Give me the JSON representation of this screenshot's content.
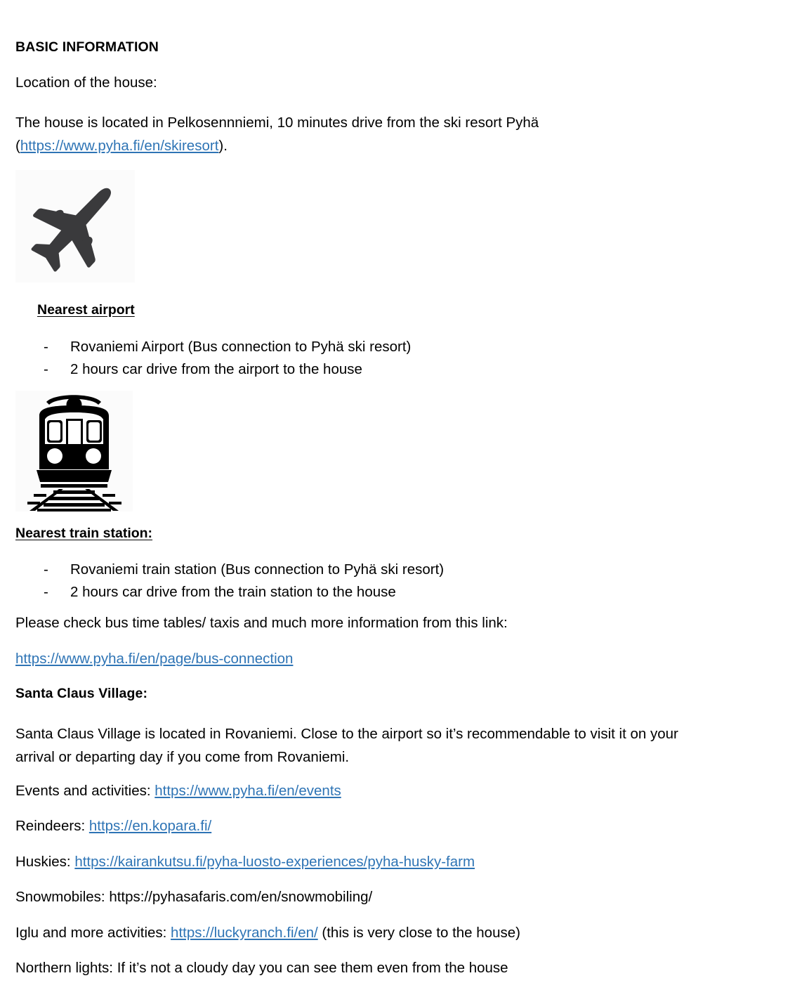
{
  "document": {
    "title": "BASIC INFORMATION",
    "location_label": "Location of the house:",
    "location_text_before": " The house is located in Pelkosennniemi, 10 minutes drive from the ski resort Pyhä (",
    "location_link": "https://www.pyha.fi/en/skiresort",
    "location_text_after": ")."
  },
  "airport_section": {
    "icon": "airplane-icon",
    "heading": "Nearest airport",
    "items": [
      {
        "dash": "-",
        "text": "Rovaniemi Airport (Bus connection to Pyhä ski resort)"
      },
      {
        "dash": "-",
        "text": "2 hours car drive from the airport to the house"
      }
    ]
  },
  "train_section": {
    "icon": "train-icon",
    "heading": "Nearest train station:",
    "items": [
      {
        "dash": "-",
        "text": "Rovaniemi train station (Bus connection to Pyhä ski resort)"
      },
      {
        "dash": "-",
        "text": "2 hours car drive from the train station to the house"
      }
    ],
    "bus_note": "Please check bus time tables/ taxis and much more information from this link:",
    "bus_link": "https://www.pyha.fi/en/page/bus-connection"
  },
  "santa_section": {
    "heading": "Santa Claus Village:",
    "description": "Santa Claus Village is located in Rovaniemi. Close to the airport so it’s recommendable to visit it on your arrival or departing day if you come from Rovaniemi."
  },
  "activities": {
    "events_label": "Events and activities: ",
    "events_link": "https://www.pyha.fi/en/events",
    "reindeers_label": "Reindeers: ",
    "reindeers_link": "https://en.kopara.fi/",
    "huskies_label": "Huskies: ",
    "huskies_link": "https://kairankutsu.fi/pyha-luosto-experiences/pyha-husky-farm",
    "snowmobiles_label": "Snowmobiles: ",
    "snowmobiles_url": "https://pyhasafaris.com/en/snowmobiling/",
    "iglu_label": "Iglu and more activities: ",
    "iglu_link": "https://luckyranch.fi/en/",
    "iglu_suffix": "  (this is very close to the house)",
    "northern_lights": "Northern lights: If it’s not a cloudy day you can see them even from the house"
  },
  "colors": {
    "link": "#2E74B5",
    "text": "#000000",
    "plane_icon": "#3A3A3C",
    "train_icon": "#000000",
    "page_background": "#FFFFFF"
  }
}
